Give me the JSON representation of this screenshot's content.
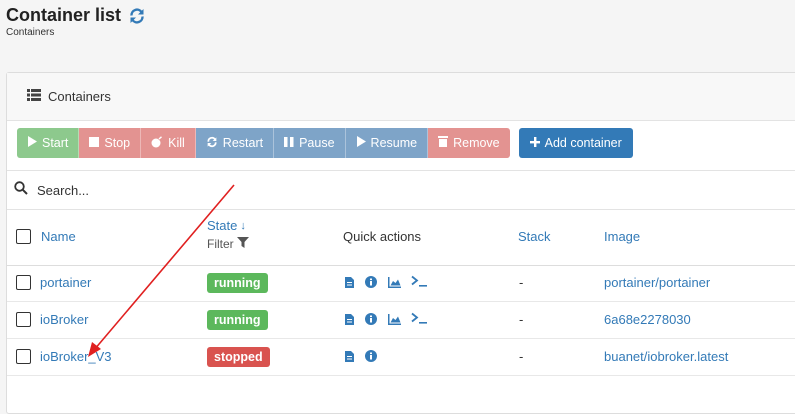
{
  "header": {
    "title": "Container list",
    "subtitle": "Containers"
  },
  "panel": {
    "title": "Containers"
  },
  "toolbar": {
    "start": "Start",
    "stop": "Stop",
    "kill": "Kill",
    "restart": "Restart",
    "pause": "Pause",
    "resume": "Resume",
    "remove": "Remove",
    "add_container": "Add container"
  },
  "search": {
    "placeholder": "Search...",
    "value": ""
  },
  "columns": {
    "name": "Name",
    "state": "State",
    "state_sort": "↓",
    "filter": "Filter",
    "quick_actions": "Quick actions",
    "stack": "Stack",
    "image": "Image"
  },
  "rows": [
    {
      "name": "portainer",
      "state": "running",
      "stack": "-",
      "image": "portainer/portainer",
      "actions": [
        "logs",
        "inspect",
        "stats",
        "console"
      ]
    },
    {
      "name": "ioBroker",
      "state": "running",
      "stack": "-",
      "image": "6a68e2278030",
      "actions": [
        "logs",
        "inspect",
        "stats",
        "console"
      ]
    },
    {
      "name": "ioBroker_V3",
      "state": "stopped",
      "stack": "-",
      "image": "buanet/iobroker.latest",
      "actions": [
        "logs",
        "inspect"
      ]
    }
  ],
  "colors": {
    "link": "#337ab7",
    "running": "#5cb85c",
    "stopped": "#d9534f",
    "annotation_arrow": "#e02020"
  }
}
